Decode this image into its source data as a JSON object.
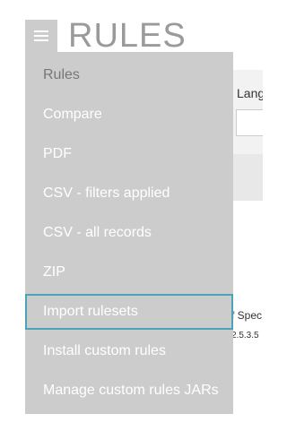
{
  "header": {
    "title": "RULES",
    "menu_icon": "hamburger-menu-icon"
  },
  "background": {
    "language_label": "Lang",
    "spec_text": "f Spec",
    "version_text": "2.5.3.5"
  },
  "menu": {
    "items": [
      {
        "label": "Rules"
      },
      {
        "label": "Compare"
      },
      {
        "label": "PDF"
      },
      {
        "label": "CSV - filters applied"
      },
      {
        "label": "CSV - all records"
      },
      {
        "label": "ZIP"
      },
      {
        "label": "Import rulesets",
        "focused": true
      },
      {
        "label": "Install custom rules"
      },
      {
        "label": "Manage custom rules JARs"
      }
    ]
  },
  "colors": {
    "menu_background": "#cccccc",
    "menu_text": "#ffffff",
    "focus_border": "#4aa3b8",
    "title": "#9a9a9a"
  }
}
